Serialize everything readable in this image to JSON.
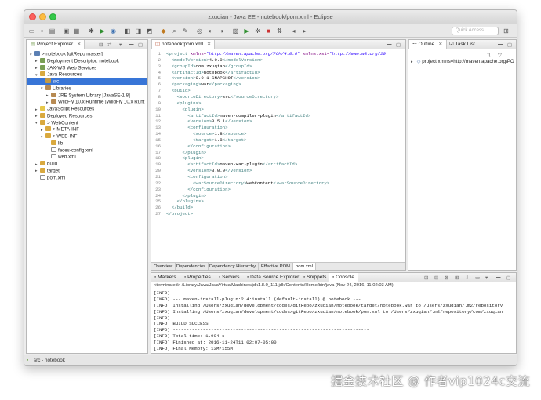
{
  "window": {
    "title": "zxuqian - Java EE - notebook/pom.xml - Eclipse"
  },
  "toolbar": {
    "quick_access_placeholder": "Quick Access"
  },
  "explorer": {
    "tab_label": "Project Explorer",
    "items": [
      {
        "label": "> notebook [gitRepo master]",
        "arrow": "▾",
        "icon": "proj",
        "selected": false
      },
      {
        "label": "Deployment Descriptor: notebook",
        "arrow": "▸",
        "icon": "dd",
        "selected": false
      },
      {
        "label": "JAX-WS Web Services",
        "arrow": "▸",
        "icon": "dd",
        "selected": false
      },
      {
        "label": "Java Resources",
        "arrow": "▾",
        "icon": "folder",
        "selected": false
      },
      {
        "label": "src",
        "arrow": "",
        "icon": "src",
        "selected": true
      },
      {
        "label": "Libraries",
        "arrow": "▾",
        "icon": "lib",
        "selected": false
      },
      {
        "label": "JRE System Library [JavaSE-1.8]",
        "arrow": "▸",
        "icon": "lib",
        "selected": false
      },
      {
        "label": "WildFly 10.x Runtime [WildFly 10.x Runt",
        "arrow": "▸",
        "icon": "lib",
        "selected": false
      },
      {
        "label": "JavaScript Resources",
        "arrow": "▸",
        "icon": "js",
        "selected": false
      },
      {
        "label": "Deployed Resources",
        "arrow": "▸",
        "icon": "folder",
        "selected": false
      },
      {
        "label": "> WebContent",
        "arrow": "▾",
        "icon": "folder",
        "selected": false
      },
      {
        "label": "> META-INF",
        "arrow": "▸",
        "icon": "folder",
        "selected": false
      },
      {
        "label": "> WEB-INF",
        "arrow": "▾",
        "icon": "folder",
        "selected": false
      },
      {
        "label": "lib",
        "arrow": "",
        "icon": "folder",
        "selected": false
      },
      {
        "label": "faces-config.xml",
        "arrow": "",
        "icon": "file",
        "selected": false
      },
      {
        "label": "web.xml",
        "arrow": "",
        "icon": "file",
        "selected": false
      },
      {
        "label": "build",
        "arrow": "▸",
        "icon": "folder",
        "selected": false
      },
      {
        "label": "target",
        "arrow": "▸",
        "icon": "folder",
        "selected": false
      },
      {
        "label": "pom.xml",
        "arrow": "",
        "icon": "file",
        "selected": false
      }
    ],
    "indents": [
      0,
      1,
      1,
      1,
      2,
      2,
      3,
      3,
      1,
      1,
      1,
      2,
      2,
      3,
      3,
      3,
      1,
      1,
      1
    ]
  },
  "editor": {
    "tab_label": "notebook/pom.xml",
    "lines": [
      {
        "n": "1",
        "html": "<span class='tg'>&lt;project</span> <span class='attr'>xmlns=</span><span class='str'>\"http://maven.apache.org/POM/4.0.0\"</span> <span class='attr'>xmlns:xsi=</span><span class='str'>\"http://www.w3.org/20</span>"
      },
      {
        "n": "2",
        "html": "  <span class='tg'>&lt;modelVersion&gt;</span><span class='txt'>4.0.0</span><span class='tg'>&lt;/modelVersion&gt;</span>"
      },
      {
        "n": "3",
        "html": "  <span class='tg'>&lt;groupId&gt;</span><span class='txt'>com.zxuqian</span><span class='tg'>&lt;/groupId&gt;</span>"
      },
      {
        "n": "4",
        "html": "  <span class='tg'>&lt;artifactId&gt;</span><span class='txt'>notebook</span><span class='tg'>&lt;/artifactId&gt;</span>"
      },
      {
        "n": "5",
        "html": "  <span class='tg'>&lt;version&gt;</span><span class='txt'>0.0.1-SNAPSHOT</span><span class='tg'>&lt;/version&gt;</span>"
      },
      {
        "n": "6",
        "html": "  <span class='tg'>&lt;packaging&gt;</span><span class='txt'>war</span><span class='tg'>&lt;/packaging&gt;</span>"
      },
      {
        "n": "7",
        "html": "  <span class='tg'>&lt;build&gt;</span>"
      },
      {
        "n": "8",
        "html": "    <span class='tg'>&lt;sourceDirectory&gt;</span><span class='txt'>src</span><span class='tg'>&lt;/sourceDirectory&gt;</span>"
      },
      {
        "n": "9",
        "html": "    <span class='tg'>&lt;plugins&gt;</span>"
      },
      {
        "n": "10",
        "html": "      <span class='tg'>&lt;plugin&gt;</span>"
      },
      {
        "n": "11",
        "html": "        <span class='tg'>&lt;artifactId&gt;</span><span class='txt'>maven-compiler-plugin</span><span class='tg'>&lt;/artifactId&gt;</span>"
      },
      {
        "n": "12",
        "html": "        <span class='tg'>&lt;version&gt;</span><span class='txt'>3.5.1</span><span class='tg'>&lt;/version&gt;</span>"
      },
      {
        "n": "13",
        "html": "        <span class='tg'>&lt;configuration&gt;</span>"
      },
      {
        "n": "14",
        "html": "          <span class='tg'>&lt;source&gt;</span><span class='txt'>1.8</span><span class='tg'>&lt;/source&gt;</span>"
      },
      {
        "n": "15",
        "html": "          <span class='tg'>&lt;target&gt;</span><span class='txt'>1.8</span><span class='tg'>&lt;/target&gt;</span>"
      },
      {
        "n": "16",
        "html": "        <span class='tg'>&lt;/configuration&gt;</span>"
      },
      {
        "n": "17",
        "html": "      <span class='tg'>&lt;/plugin&gt;</span>"
      },
      {
        "n": "18",
        "html": "      <span class='tg'>&lt;plugin&gt;</span>"
      },
      {
        "n": "19",
        "html": "        <span class='tg'>&lt;artifactId&gt;</span><span class='txt'>maven-war-plugin</span><span class='tg'>&lt;/artifactId&gt;</span>"
      },
      {
        "n": "20",
        "html": "        <span class='tg'>&lt;version&gt;</span><span class='txt'>3.0.0</span><span class='tg'>&lt;/version&gt;</span>"
      },
      {
        "n": "21",
        "html": "        <span class='tg'>&lt;configuration&gt;</span>"
      },
      {
        "n": "22",
        "html": "          <span class='tg'>&lt;warSourceDirectory&gt;</span><span class='txt'>WebContent</span><span class='tg'>&lt;/warSourceDirectory&gt;</span>"
      },
      {
        "n": "23",
        "html": "        <span class='tg'>&lt;/configuration&gt;</span>"
      },
      {
        "n": "24",
        "html": "      <span class='tg'>&lt;/plugin&gt;</span>"
      },
      {
        "n": "25",
        "html": "    <span class='tg'>&lt;/plugins&gt;</span>"
      },
      {
        "n": "26",
        "html": "  <span class='tg'>&lt;/build&gt;</span>"
      },
      {
        "n": "27",
        "html": "<span class='tg'>&lt;/project&gt;</span>"
      }
    ],
    "bottom_tabs": [
      "Overview",
      "Dependencies",
      "Dependency Hierarchy",
      "Effective POM",
      "pom.xml"
    ]
  },
  "outline": {
    "tab_label": "Outline",
    "tab2_label": "Task List",
    "root": "project xmlns=http://maven.apache.org/PO"
  },
  "console": {
    "tabs": [
      "Markers",
      "Properties",
      "Servers",
      "Data Source Explorer",
      "Snippets",
      "Console"
    ],
    "header": "<terminated> /Library/Java/JavaVirtualMachines/jdk1.8.0_111.jdk/Contents/Home/bin/java (Nov 24, 2016, 11:02:03 AM)",
    "lines": [
      "[INFO]",
      "[INFO] --- maven-install-plugin:2.4:install (default-install) @ notebook ---",
      "[INFO] Installing /Users/zxuqian/development/codes/gitRepo/zxuqian/notebook/target/notebook.war to /Users/zxuqian/.m2/repository",
      "[INFO] Installing /Users/zxuqian/development/codes/gitRepo/zxuqian/notebook/pom.xml to /Users/zxuqian/.m2/repository/com/zxuqian",
      "[INFO] ------------------------------------------------------------------------",
      "[INFO] BUILD SUCCESS",
      "[INFO] ------------------------------------------------------------------------",
      "[INFO] Total time: 1.994 s",
      "[INFO] Finished at: 2016-11-24T11:02:07-05:00",
      "[INFO] Final Memory: 13M/155M",
      "[INFO] ------------------------------------------------------------------------"
    ]
  },
  "statusbar": {
    "text": "src - notebook"
  },
  "watermark": {
    "text": "掘金技术社区 @ 作者vip1024c交流"
  }
}
